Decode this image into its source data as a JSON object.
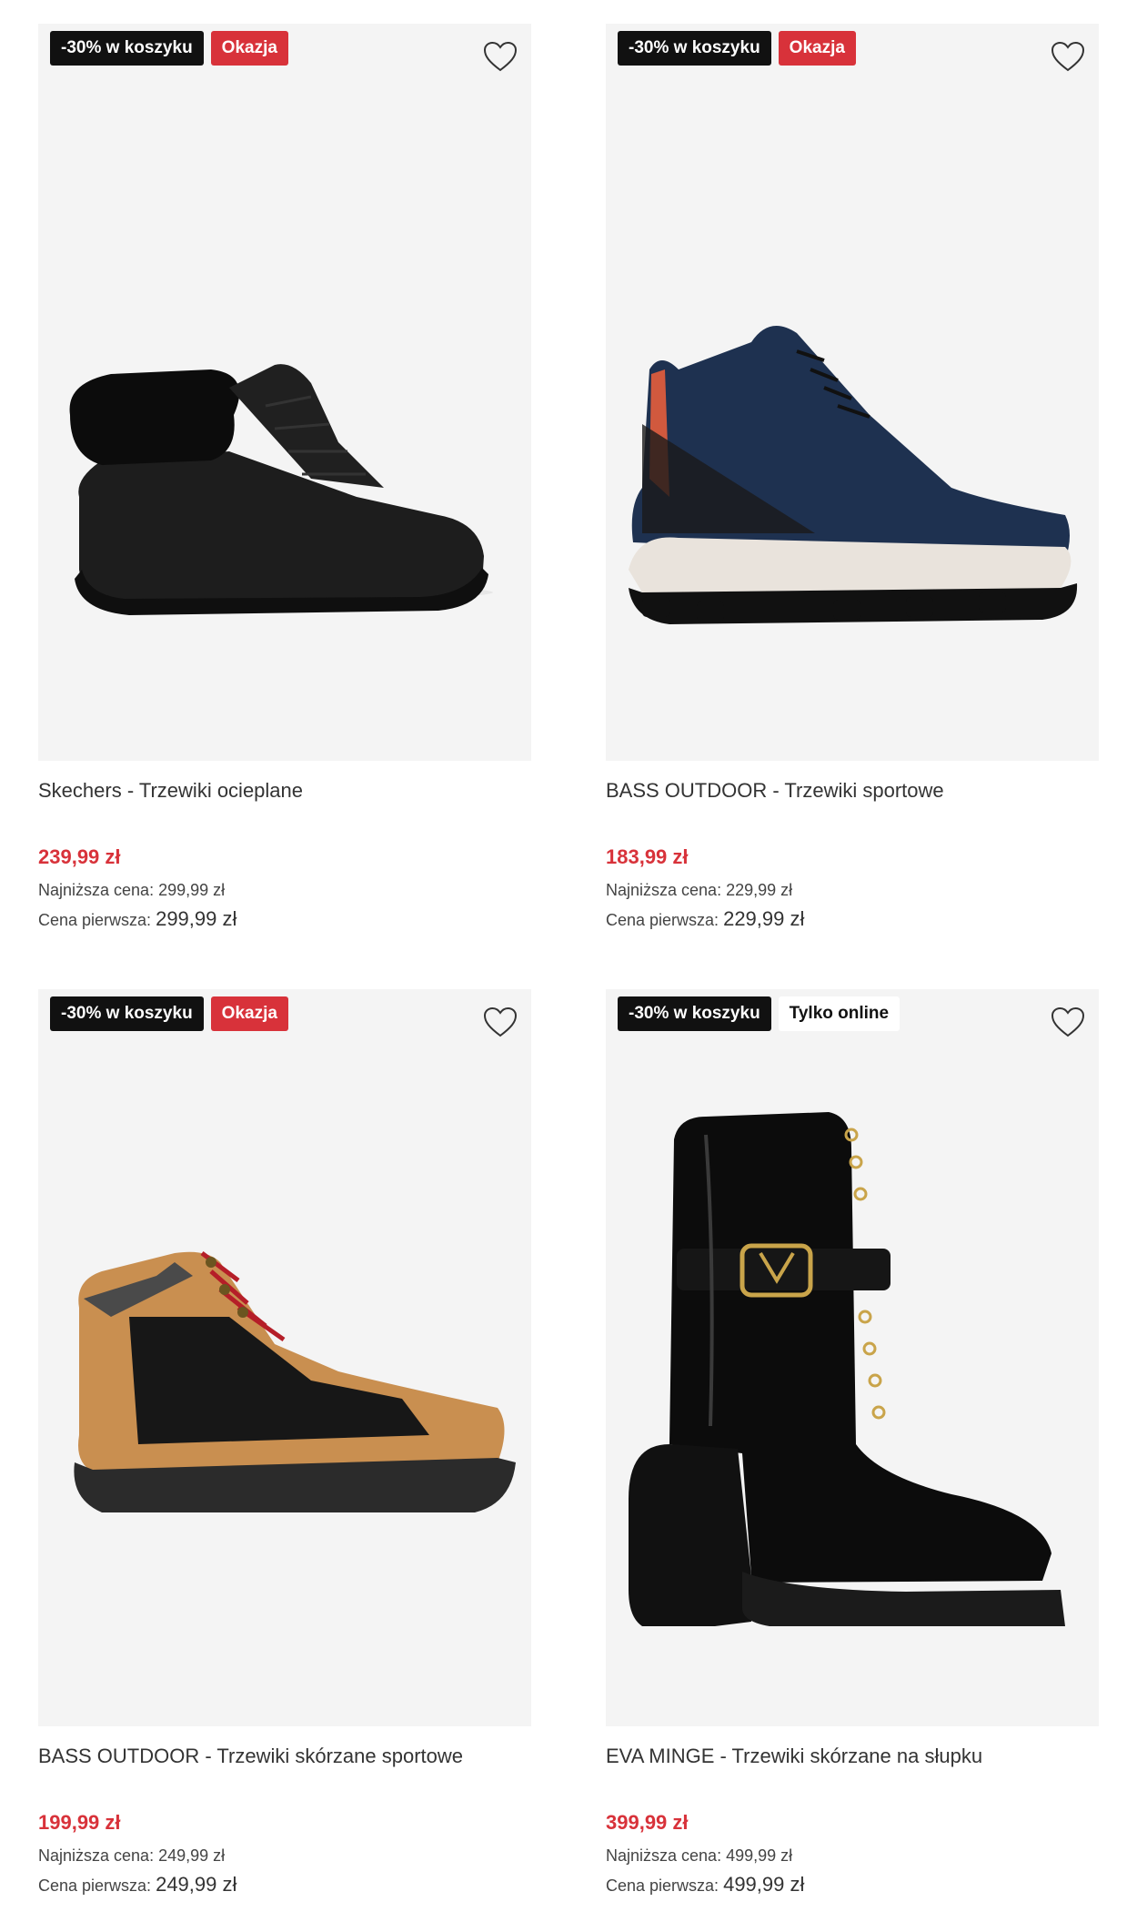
{
  "colors": {
    "accent_red": "#d8323a",
    "badge_black": "#111111",
    "image_bg": "#f4f4f4"
  },
  "labels": {
    "lowest_price": "Najniższa cena:",
    "first_price": "Cena pierwsza:"
  },
  "products": [
    {
      "badges": [
        "-30% w koszyku",
        "Okazja"
      ],
      "title": "Skechers - Trzewiki ocieplane",
      "price": "239,99 zł",
      "lowest": "299,99 zł",
      "first": "299,99 zł",
      "image_icon": "black-fur-sneaker-boot"
    },
    {
      "badges": [
        "-30% w koszyku",
        "Okazja"
      ],
      "title": "BASS OUTDOOR - Trzewiki sportowe",
      "price": "183,99 zł",
      "lowest": "229,99 zł",
      "first": "229,99 zł",
      "image_icon": "navy-hiking-sneaker"
    },
    {
      "badges": [
        "-30% w koszyku",
        "Okazja"
      ],
      "title": "BASS OUTDOOR - Trzewiki skórzane sportowe",
      "price": "199,99 zł",
      "lowest": "249,99 zł",
      "first": "249,99 zł",
      "image_icon": "tan-hiking-boot"
    },
    {
      "badges": [
        "-30% w koszyku",
        "Tylko online"
      ],
      "title": "EVA MINGE - Trzewiki skórzane na słupku",
      "price": "399,99 zł",
      "lowest": "499,99 zł",
      "first": "499,99 zł",
      "image_icon": "black-patent-heeled-boot"
    }
  ]
}
